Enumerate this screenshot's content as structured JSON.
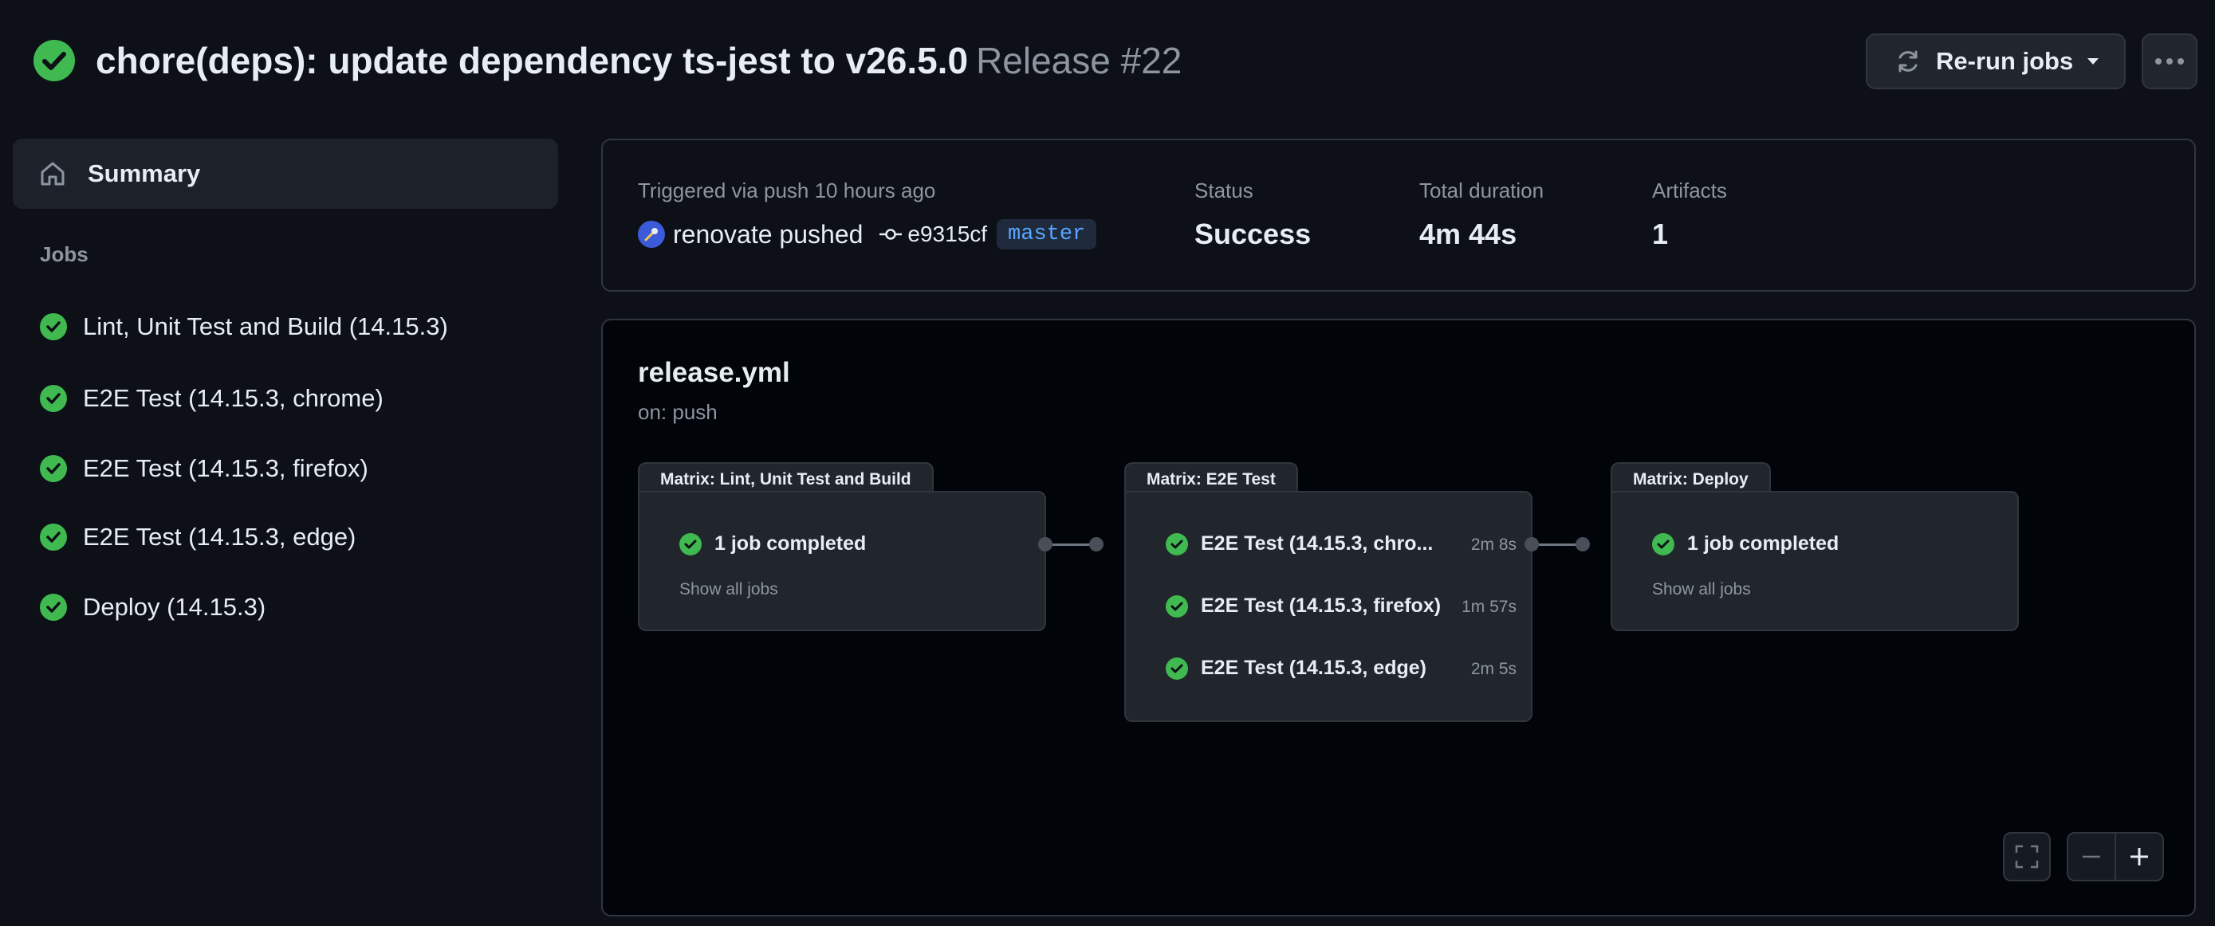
{
  "header": {
    "title": "chore(deps): update dependency ts-jest to v26.5.0",
    "run_label": "Release #22",
    "rerun_label": "Re-run jobs"
  },
  "sidebar": {
    "summary_label": "Summary",
    "jobs_heading": "Jobs",
    "jobs": [
      {
        "label": "Lint, Unit Test and Build (14.15.3)"
      },
      {
        "label": "E2E Test (14.15.3, chrome)"
      },
      {
        "label": "E2E Test (14.15.3, firefox)"
      },
      {
        "label": "E2E Test (14.15.3, edge)"
      },
      {
        "label": "Deploy (14.15.3)"
      }
    ]
  },
  "info": {
    "trigger": "Triggered via push 10 hours ago",
    "actor": "renovate pushed",
    "commit": "e9315cf",
    "branch": "master",
    "status_label": "Status",
    "status_value": "Success",
    "duration_label": "Total duration",
    "duration_value": "4m 44s",
    "artifacts_label": "Artifacts",
    "artifacts_value": "1"
  },
  "workflow": {
    "file": "release.yml",
    "trigger": "on: push",
    "matrices": [
      {
        "title": "Matrix: Lint, Unit Test and Build",
        "summary": "1 job completed",
        "show_all": "Show all jobs"
      },
      {
        "title": "Matrix: E2E Test",
        "jobs": [
          {
            "label": "E2E Test (14.15.3, chro...",
            "duration": "2m 8s"
          },
          {
            "label": "E2E Test (14.15.3, firefox)",
            "duration": "1m 57s"
          },
          {
            "label": "E2E Test (14.15.3, edge)",
            "duration": "2m 5s"
          }
        ]
      },
      {
        "title": "Matrix: Deploy",
        "summary": "1 job completed",
        "show_all": "Show all jobs"
      }
    ]
  },
  "colors": {
    "success": "#3fb950",
    "background": "#0d1117",
    "link": "#58a6ff"
  },
  "icons": [
    "check-circle-icon",
    "sync-icon",
    "caret-down-icon",
    "kebab-horizontal-icon",
    "home-icon",
    "git-commit-icon",
    "fullscreen-icon",
    "zoom-out-icon",
    "zoom-in-icon"
  ]
}
